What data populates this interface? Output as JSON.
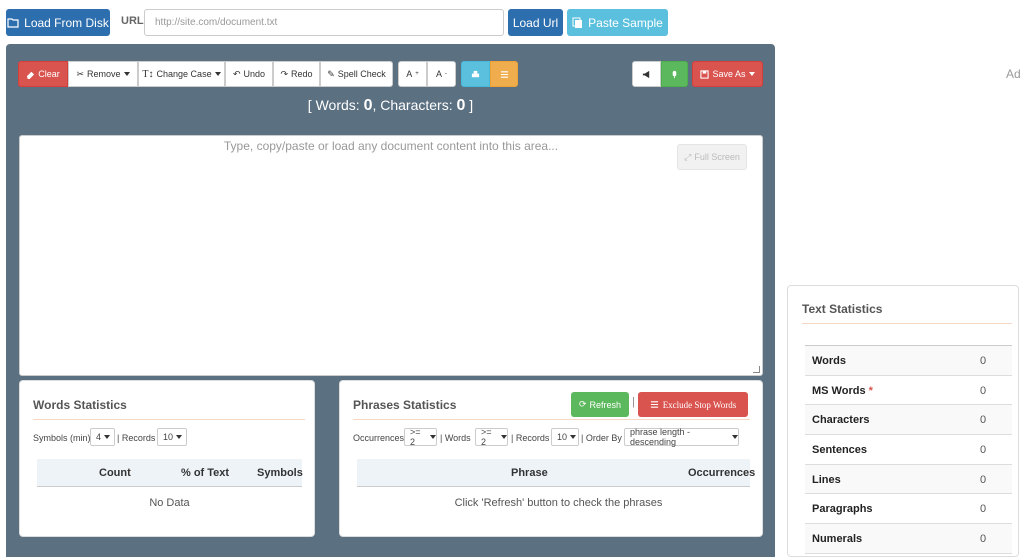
{
  "topbar": {
    "load_disk": "Load From Disk",
    "url_label": "URL",
    "url_placeholder": "http://site.com/document.txt",
    "load_url": "Load Url",
    "paste_sample": "Paste Sample"
  },
  "ad_text": "Ad",
  "toolbar": {
    "clear": "Clear",
    "remove": "Remove",
    "change_case": "Change Case",
    "undo": "Undo",
    "redo": "Redo",
    "spell_check": "Spell Check",
    "font_up": "A",
    "font_down": "A",
    "save_as": "Save As"
  },
  "counter": {
    "words_label": "Words:",
    "words": "0",
    "chars_label": "Characters:",
    "chars": "0"
  },
  "editor": {
    "placeholder": "Type, copy/paste or load any document content into this area...",
    "full_screen": "Full Screen"
  },
  "words_stats": {
    "title": "Words Statistics",
    "symbols_label": "Symbols (min)",
    "symbols_value": "4",
    "records_label": "| Records",
    "records_value": "10",
    "columns": [
      "Count",
      "% of Text",
      "Symbols"
    ],
    "empty": "No Data"
  },
  "phrases_stats": {
    "title": "Phrases Statistics",
    "refresh": "Refresh",
    "exclude": "Exclude Stop Words",
    "occ_label": "Occurrences",
    "occ_value": ">= 2",
    "words_label": "| Words",
    "words_value": ">= 2",
    "records_label": "| Records",
    "records_value": "10",
    "order_label": "| Order By",
    "order_value": "phrase length - descending",
    "columns": [
      "Phrase",
      "Occurrences"
    ],
    "empty": "Click 'Refresh' button to check the phrases"
  },
  "text_stats": {
    "title": "Text Statistics",
    "rows": [
      {
        "label": "Words",
        "value": "0"
      },
      {
        "label": "MS Words",
        "value": "0"
      },
      {
        "label": "Characters",
        "value": "0"
      },
      {
        "label": "Sentences",
        "value": "0"
      },
      {
        "label": "Lines",
        "value": "0"
      },
      {
        "label": "Paragraphs",
        "value": "0"
      },
      {
        "label": "Numerals",
        "value": "0"
      }
    ]
  }
}
